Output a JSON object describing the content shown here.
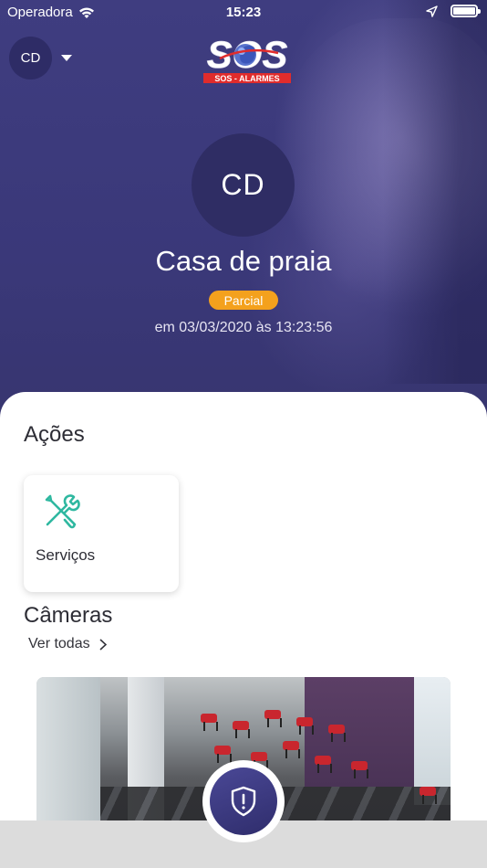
{
  "status_bar": {
    "carrier": "Operadora",
    "time": "15:23"
  },
  "header": {
    "account_initials": "CD",
    "logo_text": "SOS",
    "logo_subtext": "SOS - ALARMES"
  },
  "profile": {
    "initials": "CD",
    "name": "Casa de praia",
    "status_badge": "Parcial",
    "status_color": "#f4a11d",
    "timestamp": "em 03/03/2020 às 13:23:56"
  },
  "actions": {
    "title": "Ações",
    "items": [
      {
        "label": "Serviços",
        "icon": "tools-icon",
        "icon_color": "#2fb8a0"
      }
    ]
  },
  "cameras": {
    "title": "Câmeras",
    "see_all": "Ver todas"
  },
  "colors": {
    "brand_purple": "#3a3877",
    "accent_orange": "#f4a11d",
    "accent_teal": "#2fb8a0"
  }
}
